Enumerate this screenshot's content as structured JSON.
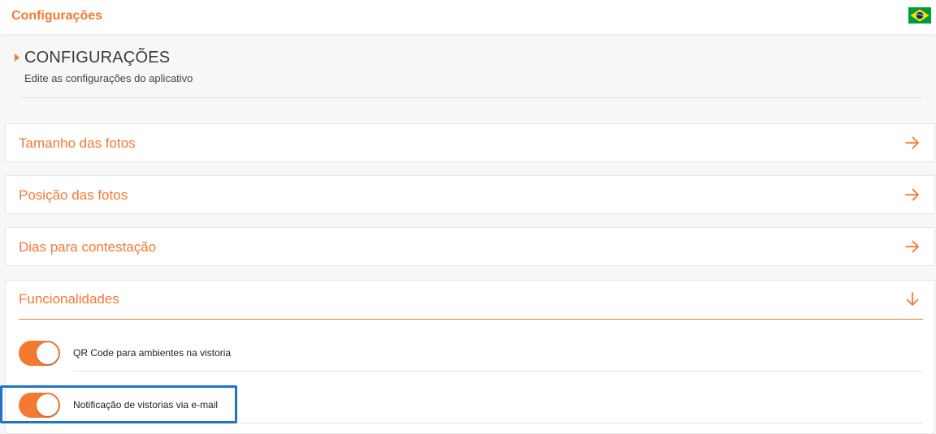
{
  "header": {
    "app_title": "Configurações",
    "language_flag_icon": "brazil-flag-icon",
    "flag_colors": {
      "green": "#009c3b",
      "yellow": "#ffdf00",
      "blue": "#002776"
    }
  },
  "section": {
    "title": "CONFIGURAÇÕES",
    "subtitle": "Edite as configurações do aplicativo"
  },
  "menu_items": [
    {
      "label": "Tamanho das fotos",
      "icon": "arrow-right-icon"
    },
    {
      "label": "Posição das fotos",
      "icon": "arrow-right-icon"
    },
    {
      "label": "Dias para contestação",
      "icon": "arrow-right-icon"
    }
  ],
  "features": {
    "label": "Funcionalidades",
    "icon": "arrow-down-icon",
    "items": [
      {
        "label": "QR Code para ambientes na vistoria",
        "enabled": true
      },
      {
        "label": "Notificação de vistorias via e-mail",
        "enabled": true
      }
    ]
  },
  "colors": {
    "accent": "#f47a32",
    "highlight": "#1f73c9"
  }
}
